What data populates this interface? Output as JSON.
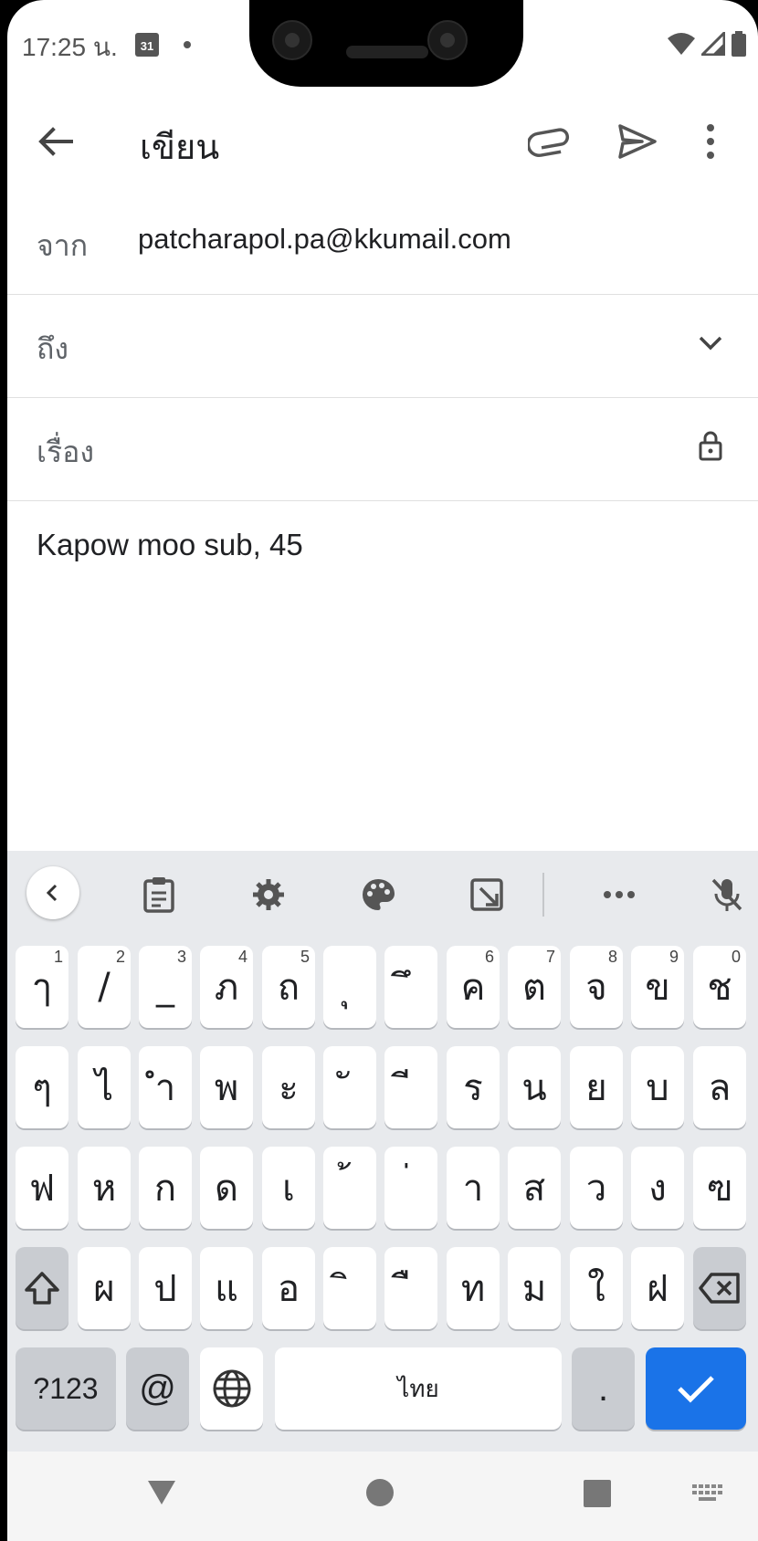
{
  "status": {
    "time": "17:25 น.",
    "calendar_day": "31"
  },
  "appbar": {
    "title": "เขียน"
  },
  "compose": {
    "from_label": "จาก",
    "from_value": "patcharapol.pa@kkumail.com",
    "to_label": "ถึง",
    "subject_label": "เรื่อง",
    "body": "Kapow moo sub, 45"
  },
  "keyboard": {
    "row1": [
      {
        "k": "ๅ",
        "h": "1"
      },
      {
        "k": "/",
        "h": "2"
      },
      {
        "k": "_",
        "h": "3"
      },
      {
        "k": "ภ",
        "h": "4"
      },
      {
        "k": "ถ",
        "h": "5"
      },
      {
        "k": "ุ",
        "h": ""
      },
      {
        "k": "ึ",
        "h": ""
      },
      {
        "k": "ค",
        "h": "6"
      },
      {
        "k": "ต",
        "h": "7"
      },
      {
        "k": "จ",
        "h": "8"
      },
      {
        "k": "ข",
        "h": "9"
      },
      {
        "k": "ช",
        "h": "0"
      }
    ],
    "row2": [
      "ๆ",
      "ไ",
      "ำ",
      "พ",
      "ะ",
      "ั",
      "ี",
      "ร",
      "น",
      "ย",
      "บ",
      "ล"
    ],
    "row3": [
      "ฟ",
      "ห",
      "ก",
      "ด",
      "เ",
      "้",
      "่",
      "า",
      "ส",
      "ว",
      "ง",
      "ฃ"
    ],
    "row4": [
      "ผ",
      "ป",
      "แ",
      "อ",
      "ิ",
      "ื",
      "ท",
      "ม",
      "ใ",
      "ฝ"
    ],
    "symbols_label": "?123",
    "at_label": "@",
    "space_label": "ไทย",
    "period_label": "."
  }
}
